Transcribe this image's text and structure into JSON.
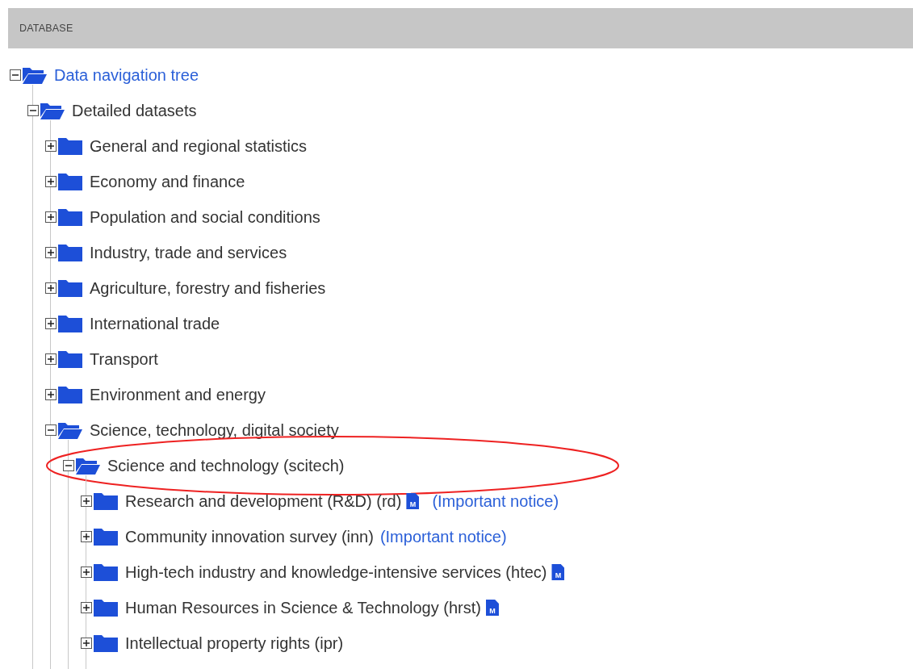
{
  "header": {
    "title": "DATABASE"
  },
  "tree": [
    {
      "label": "Data navigation tree",
      "link": true,
      "expanded": true,
      "children": [
        {
          "label": "Detailed datasets",
          "expanded": true,
          "children": [
            {
              "label": "General and regional statistics",
              "expanded": false
            },
            {
              "label": "Economy and finance",
              "expanded": false
            },
            {
              "label": "Population and social conditions",
              "expanded": false
            },
            {
              "label": "Industry, trade and services",
              "expanded": false
            },
            {
              "label": "Agriculture, forestry and fisheries",
              "expanded": false
            },
            {
              "label": "International trade",
              "expanded": false
            },
            {
              "label": "Transport",
              "expanded": false
            },
            {
              "label": "Environment and energy",
              "expanded": false
            },
            {
              "label": "Science, technology, digital society",
              "expanded": true,
              "children": [
                {
                  "label": "Science and technology (scitech)",
                  "expanded": true,
                  "highlighted": true,
                  "children": [
                    {
                      "label": "Research and development (R&D) (rd)",
                      "expanded": false,
                      "metadata": "M",
                      "notice": "(Important notice)"
                    },
                    {
                      "label": "Community innovation survey (inn)",
                      "expanded": false,
                      "notice": "(Important notice)"
                    },
                    {
                      "label": "High-tech industry and knowledge-intensive services (htec)",
                      "expanded": false,
                      "metadata": "M"
                    },
                    {
                      "label": "Human Resources in Science & Technology (hrst)",
                      "expanded": false,
                      "metadata": "M"
                    },
                    {
                      "label": "Intellectual property rights (ipr)",
                      "expanded": false
                    }
                  ]
                }
              ]
            }
          ]
        }
      ]
    }
  ]
}
